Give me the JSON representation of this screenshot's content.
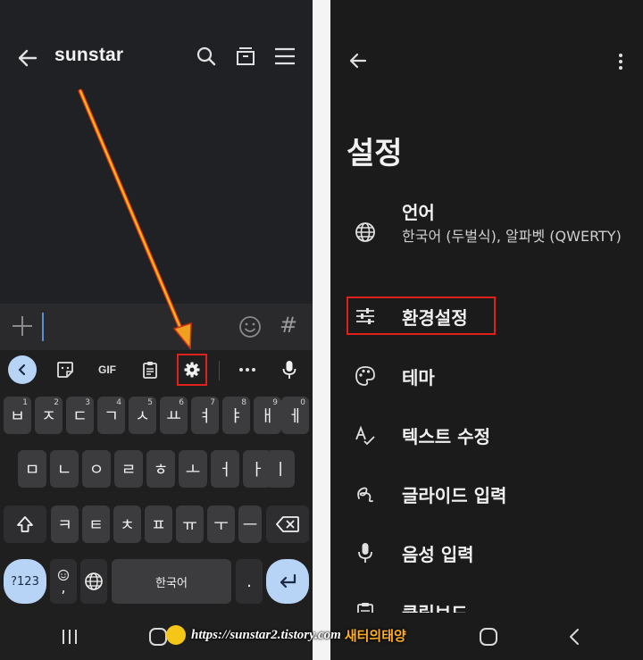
{
  "left": {
    "chat_title": "sunstar",
    "composer": {
      "hash_label": "#"
    },
    "toolbar": {
      "gif_label": "GIF"
    },
    "keys": {
      "row1": [
        {
          "label": "ㅂ",
          "hint": "1"
        },
        {
          "label": "ㅈ",
          "hint": "2"
        },
        {
          "label": "ㄷ",
          "hint": "3"
        },
        {
          "label": "ㄱ",
          "hint": "4"
        },
        {
          "label": "ㅅ",
          "hint": "5"
        },
        {
          "label": "ㅛ",
          "hint": "6"
        },
        {
          "label": "ㅕ",
          "hint": "7"
        },
        {
          "label": "ㅑ",
          "hint": "8"
        },
        {
          "label": "ㅐ",
          "hint": "9"
        },
        {
          "label": "ㅔ",
          "hint": "0"
        }
      ],
      "row2": [
        "ㅁ",
        "ㄴ",
        "ㅇ",
        "ㄹ",
        "ㅎ",
        "ㅗ",
        "ㅓ",
        "ㅏ",
        "ㅣ"
      ],
      "row3": [
        "ㅋ",
        "ㅌ",
        "ㅊ",
        "ㅍ",
        "ㅠ",
        "ㅜ",
        "ㅡ"
      ],
      "symbols_label": "?123",
      "comma_label": ",",
      "space_label": "한국어",
      "period_label": "."
    }
  },
  "right": {
    "title": "설정",
    "items": [
      {
        "label": "언어",
        "subtitle": "한국어 (두벌식), 알파벳 (QWERTY)",
        "icon": "globe-icon"
      },
      {
        "label": "환경설정",
        "icon": "sliders-icon"
      },
      {
        "label": "테마",
        "icon": "palette-icon"
      },
      {
        "label": "텍스트 수정",
        "icon": "text-correction-icon"
      },
      {
        "label": "글라이드 입력",
        "icon": "glide-icon"
      },
      {
        "label": "음성 입력",
        "icon": "mic-icon"
      },
      {
        "label": "클립보드",
        "icon": "clipboard-icon"
      }
    ]
  },
  "watermark": {
    "url": "https://sunstar2.tistory.com",
    "brand": "새터의태양"
  },
  "colors": {
    "highlight_box": "#e0211b",
    "arrow": "#f0a020",
    "accent_key": "#b7d3f6"
  }
}
